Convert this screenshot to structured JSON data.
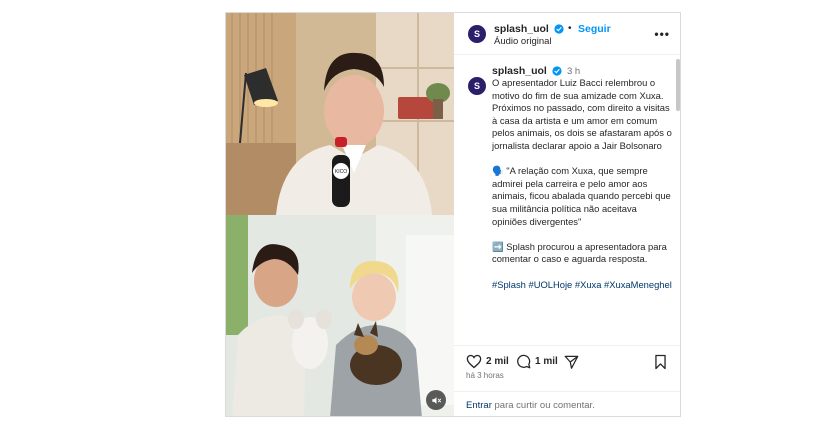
{
  "post": {
    "author": "splash_uol",
    "verified": true,
    "follow_label": "Seguir",
    "audio_label": "Áudio original",
    "more_icon": "more-horizontal-icon"
  },
  "caption": {
    "author": "splash_uol",
    "time": "3 h",
    "paragraphs": [
      "O apresentador Luiz Bacci relembrou o motivo do fim de sua amizade com Xuxa. Próximos no passado, com direito a visitas à casa da artista e um amor em comum pelos animais, os dois se afastaram após o jornalista declarar apoio a Jair Bolsonaro",
      "🗣️ \"A relação com Xuxa, que sempre admirei pela carreira e pelo amor aos animais, ficou abalada quando percebi que sua militância política não aceitava opiniões divergentes\"",
      "➡️ Splash procurou a apresentadora para comentar o caso e aguarda resposta."
    ],
    "hashtags": "#Splash #UOLHoje #Xuxa #XuxaMeneghel"
  },
  "actions": {
    "likes": "2 mil",
    "comments": "1 mil",
    "time_ago": "há 3 horas"
  },
  "comment_bar": {
    "login_link": "Entrar",
    "prompt": " para curtir ou comentar."
  },
  "media": {
    "mic_label": "KICO"
  },
  "colors": {
    "accent": "#0095f6",
    "avatar_bg": "#2b1f6b",
    "hashtag": "#00376b"
  }
}
